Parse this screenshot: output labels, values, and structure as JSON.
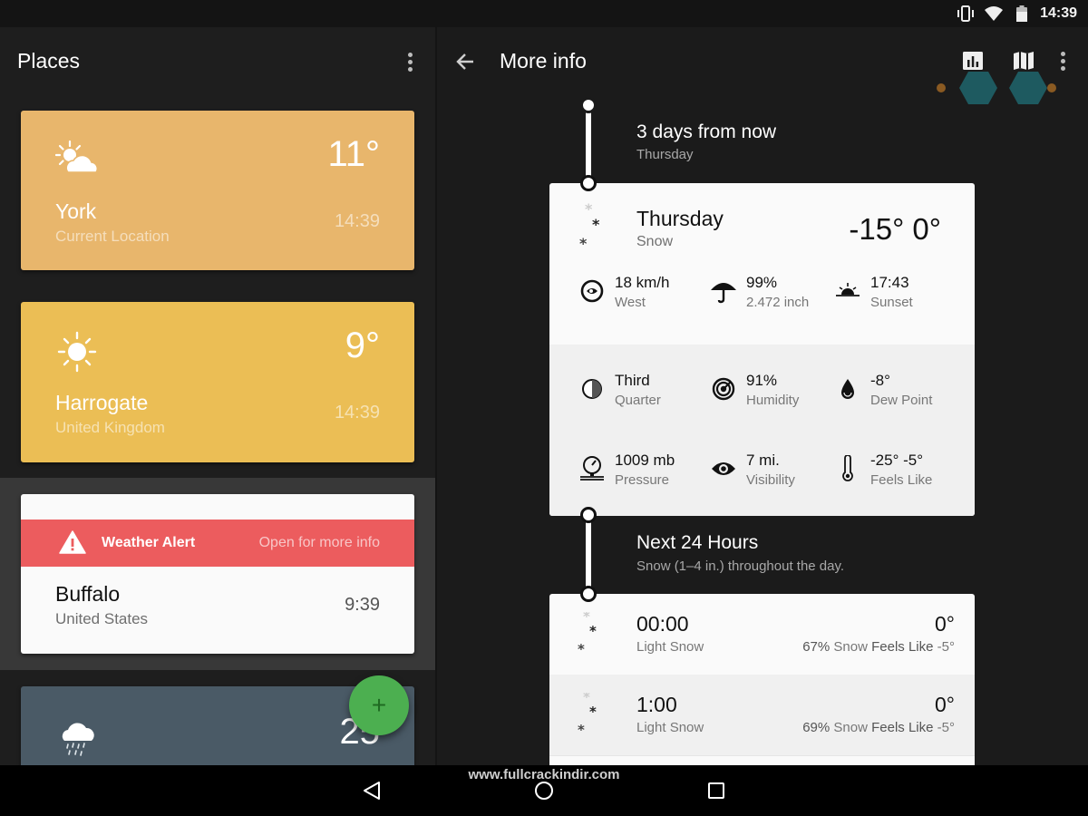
{
  "status_bar": {
    "time": "14:39",
    "icons": [
      "vibrate-icon",
      "wifi-icon",
      "battery-icon"
    ]
  },
  "places_pane": {
    "title": "Places",
    "menu_icon": "overflow-menu-icon",
    "add_button_icon": "plus-icon",
    "places": [
      {
        "city": "York",
        "subtitle": "Current Location",
        "temperature": "11°",
        "time": "14:39",
        "weather_icon": "partly-cloudy-icon",
        "color": "#e8b66c"
      },
      {
        "city": "Harrogate",
        "subtitle": "United Kingdom",
        "temperature": "9°",
        "time": "14:39",
        "weather_icon": "sunny-icon",
        "color": "#ebbe55"
      },
      {
        "city": "Buffalo",
        "subtitle": "United States",
        "temperature": "",
        "time": "9:39",
        "weather_icon": "",
        "color": "#fafafa",
        "alert": {
          "title": "Weather Alert",
          "link": "Open for more info",
          "icon": "warning-icon",
          "color": "#ec5c5e"
        }
      },
      {
        "city": "",
        "subtitle": "",
        "temperature": "25",
        "time": "",
        "weather_icon": "rain-icon",
        "color": "#4a5a66"
      }
    ]
  },
  "detail_pane": {
    "title": "More info",
    "back_icon": "arrow-left-icon",
    "toolbar_icons": [
      "chart-icon",
      "map-icon",
      "overflow-menu-icon"
    ],
    "day_section": {
      "title": "3 days from now",
      "subtitle": "Thursday"
    },
    "day_card": {
      "day": "Thursday",
      "condition": "Snow",
      "temps": "-15° 0°",
      "weather_icon": "snow-icon",
      "stats": [
        {
          "icon": "wind-icon",
          "value": "18 km/h",
          "label": "West"
        },
        {
          "icon": "umbrella-icon",
          "value": "99%",
          "label": "2.472 inch"
        },
        {
          "icon": "sunset-icon",
          "value": "17:43",
          "label": "Sunset"
        },
        {
          "icon": "moon-phase-icon",
          "value": "Third",
          "label": "Quarter"
        },
        {
          "icon": "humidity-icon",
          "value": "91%",
          "label": "Humidity"
        },
        {
          "icon": "dew-drop-icon",
          "value": "-8°",
          "label": "Dew Point"
        },
        {
          "icon": "pressure-gauge-icon",
          "value": "1009 mb",
          "label": "Pressure"
        },
        {
          "icon": "eye-icon",
          "value": "7 mi.",
          "label": "Visibility"
        },
        {
          "icon": "thermometer-icon",
          "value": "-25° -5°",
          "label": "Feels Like"
        }
      ]
    },
    "hourly_section": {
      "title": "Next 24 Hours",
      "subtitle": "Snow (1–4 in.) throughout the day."
    },
    "hourly": [
      {
        "time": "00:00",
        "condition": "Light Snow",
        "temp": "0°",
        "chance": "67%",
        "chance_label": "Snow",
        "feels_label": "Feels Like",
        "feels": "-5°"
      },
      {
        "time": "1:00",
        "condition": "Light Snow",
        "temp": "0°",
        "chance": "69%",
        "chance_label": "Snow",
        "feels_label": "Feels Like",
        "feels": "-5°"
      }
    ]
  },
  "nav_bar": {
    "buttons": [
      "back-nav-icon",
      "home-nav-icon",
      "recents-nav-icon"
    ],
    "watermark": "www.fullcrackindir.com"
  }
}
